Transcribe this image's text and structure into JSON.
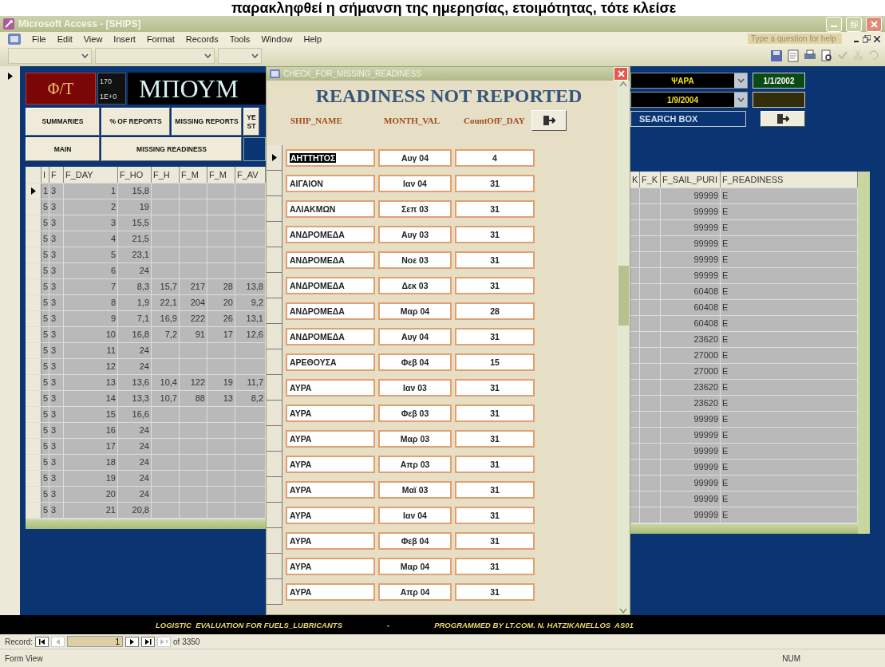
{
  "page_caption": "παρακληφθεί η σήμανση της ημερησίας, ετοιμότητας, τότε κλείσε",
  "window": {
    "title": "Microsoft Access - [SHIPS]"
  },
  "menu": [
    "File",
    "Edit",
    "View",
    "Insert",
    "Format",
    "Records",
    "Tools",
    "Window",
    "Help"
  ],
  "help_box": {
    "placeholder": "Type a question for help"
  },
  "form": {
    "badge": "Φ/Τ",
    "counter": [
      "170",
      "1E+0"
    ],
    "banner": "ΜΠΟΥΜ",
    "nav_buttons": [
      "SUMMARIES",
      "% OF REPORTS",
      "MISSING REPORTS",
      "YE ST"
    ],
    "nav_buttons_2": [
      "MAIN",
      "MISSING READINESS"
    ],
    "ship_combo": {
      "value": "ΨΑΡΑ"
    },
    "start_date": "1/1/2002",
    "end_combo": {
      "value": "1/9/2004"
    },
    "search_button": "SEARCH BOX",
    "grid_left": {
      "columns": [
        "I",
        "F",
        "F_DAY",
        "F_HO",
        "F_H",
        "F_M",
        "F_M",
        "F_AV"
      ],
      "rows": [
        {
          "selected": true,
          "cells": [
            "1",
            "3",
            "1",
            "15,8",
            "",
            "",
            "",
            ""
          ]
        },
        {
          "selected": false,
          "cells": [
            "5",
            "3",
            "2",
            "19",
            "",
            "",
            "",
            ""
          ]
        },
        {
          "selected": false,
          "cells": [
            "5",
            "3",
            "3",
            "15,5",
            "",
            "",
            "",
            ""
          ]
        },
        {
          "selected": false,
          "cells": [
            "5",
            "3",
            "4",
            "21,5",
            "",
            "",
            "",
            ""
          ]
        },
        {
          "selected": false,
          "cells": [
            "5",
            "3",
            "5",
            "23,1",
            "",
            "",
            "",
            ""
          ]
        },
        {
          "selected": false,
          "cells": [
            "5",
            "3",
            "6",
            "24",
            "",
            "",
            "",
            ""
          ]
        },
        {
          "selected": false,
          "cells": [
            "5",
            "3",
            "7",
            "8,3",
            "15,7",
            "217",
            "28",
            "13,8"
          ]
        },
        {
          "selected": false,
          "cells": [
            "5",
            "3",
            "8",
            "1,9",
            "22,1",
            "204",
            "20",
            "9,2"
          ]
        },
        {
          "selected": false,
          "cells": [
            "5",
            "3",
            "9",
            "7,1",
            "16,9",
            "222",
            "26",
            "13,1"
          ]
        },
        {
          "selected": false,
          "cells": [
            "5",
            "3",
            "10",
            "16,8",
            "7,2",
            "91",
            "17",
            "12,6"
          ]
        },
        {
          "selected": false,
          "cells": [
            "5",
            "3",
            "11",
            "24",
            "",
            "",
            "",
            ""
          ]
        },
        {
          "selected": false,
          "cells": [
            "5",
            "3",
            "12",
            "24",
            "",
            "",
            "",
            ""
          ]
        },
        {
          "selected": false,
          "cells": [
            "5",
            "3",
            "13",
            "13,6",
            "10,4",
            "122",
            "19",
            "11,7"
          ]
        },
        {
          "selected": false,
          "cells": [
            "5",
            "3",
            "14",
            "13,3",
            "10,7",
            "88",
            "13",
            "8,2"
          ]
        },
        {
          "selected": false,
          "cells": [
            "5",
            "3",
            "15",
            "16,6",
            "",
            "",
            "",
            ""
          ]
        },
        {
          "selected": false,
          "cells": [
            "5",
            "3",
            "16",
            "24",
            "",
            "",
            "",
            ""
          ]
        },
        {
          "selected": false,
          "cells": [
            "5",
            "3",
            "17",
            "24",
            "",
            "",
            "",
            ""
          ]
        },
        {
          "selected": false,
          "cells": [
            "5",
            "3",
            "18",
            "24",
            "",
            "",
            "",
            ""
          ]
        },
        {
          "selected": false,
          "cells": [
            "5",
            "3",
            "19",
            "24",
            "",
            "",
            "",
            ""
          ]
        },
        {
          "selected": false,
          "cells": [
            "5",
            "3",
            "20",
            "24",
            "",
            "",
            "",
            ""
          ]
        },
        {
          "selected": false,
          "cells": [
            "5",
            "3",
            "21",
            "20,8",
            "",
            "",
            "",
            ""
          ]
        }
      ]
    },
    "grid_right": {
      "columns": [
        "K",
        "F_K",
        "F_SAIL_PURI",
        "F_READINESS"
      ],
      "rows": [
        [
          "",
          "",
          "99999",
          "E"
        ],
        [
          "",
          "",
          "99999",
          "E"
        ],
        [
          "",
          "",
          "99999",
          "E"
        ],
        [
          "",
          "",
          "99999",
          "E"
        ],
        [
          "",
          "",
          "99999",
          "E"
        ],
        [
          "",
          "",
          "99999",
          "E"
        ],
        [
          "",
          "",
          "60408",
          "E"
        ],
        [
          "",
          "",
          "60408",
          "E"
        ],
        [
          "",
          "",
          "60408",
          "E"
        ],
        [
          "",
          "",
          "23620",
          "E"
        ],
        [
          "",
          "",
          "27000",
          "E"
        ],
        [
          "",
          "",
          "27000",
          "E"
        ],
        [
          "",
          "",
          "23620",
          "E"
        ],
        [
          "",
          "",
          "23620",
          "E"
        ],
        [
          "",
          "",
          "99999",
          "E"
        ],
        [
          "",
          "",
          "99999",
          "E"
        ],
        [
          "",
          "",
          "99999",
          "E"
        ],
        [
          "",
          "",
          "99999",
          "E"
        ],
        [
          "",
          "",
          "99999",
          "E"
        ],
        [
          "",
          "",
          "99999",
          "E"
        ],
        [
          "",
          "",
          "99999",
          "E"
        ]
      ]
    },
    "footer": [
      "LOGISTIC  EVALUATION FOR FUELS_LUBRICANTS",
      "-",
      "PROGRAMMED BY LT.COM. N. HATZIKANELLOS  AS01"
    ]
  },
  "popup": {
    "title": "CHECK_FOR_MISSING_READINESS",
    "heading": "READINESS NOT REPORTED",
    "columns": [
      "SHIP_NAME",
      "MONTH_VAL",
      "CountOfF_DAY"
    ],
    "rows": [
      {
        "selected": true,
        "ship": "ΑΗΤΤΗΤΟΣ",
        "month": "Αυγ 04",
        "count": "4"
      },
      {
        "selected": false,
        "ship": "ΑΙΓΑΙΟΝ",
        "month": "Ιαν 04",
        "count": "31"
      },
      {
        "selected": false,
        "ship": "ΑΛΙΑΚΜΩΝ",
        "month": "Σεπ 03",
        "count": "31"
      },
      {
        "selected": false,
        "ship": "ΑΝΔΡΟΜΕΔΑ",
        "month": "Αυγ 03",
        "count": "31"
      },
      {
        "selected": false,
        "ship": "ΑΝΔΡΟΜΕΔΑ",
        "month": "Νοε 03",
        "count": "31"
      },
      {
        "selected": false,
        "ship": "ΑΝΔΡΟΜΕΔΑ",
        "month": "Δεκ 03",
        "count": "31"
      },
      {
        "selected": false,
        "ship": "ΑΝΔΡΟΜΕΔΑ",
        "month": "Μαρ 04",
        "count": "28"
      },
      {
        "selected": false,
        "ship": "ΑΝΔΡΟΜΕΔΑ",
        "month": "Αυγ 04",
        "count": "31"
      },
      {
        "selected": false,
        "ship": "ΑΡΕΘΟΥΣΑ",
        "month": "Φεβ 04",
        "count": "15"
      },
      {
        "selected": false,
        "ship": "ΑΥΡΑ",
        "month": "Ιαν 03",
        "count": "31"
      },
      {
        "selected": false,
        "ship": "ΑΥΡΑ",
        "month": "Φεβ 03",
        "count": "31"
      },
      {
        "selected": false,
        "ship": "ΑΥΡΑ",
        "month": "Μαρ 03",
        "count": "31"
      },
      {
        "selected": false,
        "ship": "ΑΥΡΑ",
        "month": "Απρ 03",
        "count": "31"
      },
      {
        "selected": false,
        "ship": "ΑΥΡΑ",
        "month": "Μαϊ 03",
        "count": "31"
      },
      {
        "selected": false,
        "ship": "ΑΥΡΑ",
        "month": "Ιαν 04",
        "count": "31"
      },
      {
        "selected": false,
        "ship": "ΑΥΡΑ",
        "month": "Φεβ 04",
        "count": "31"
      },
      {
        "selected": false,
        "ship": "ΑΥΡΑ",
        "month": "Μαρ 04",
        "count": "31"
      },
      {
        "selected": false,
        "ship": "ΑΥΡΑ",
        "month": "Απρ 04",
        "count": "31"
      }
    ]
  },
  "record_nav": {
    "label": "Record:",
    "value": "1",
    "total": "of 3350"
  },
  "status_bar": {
    "mode": "Form View",
    "indicator": "NUM"
  }
}
